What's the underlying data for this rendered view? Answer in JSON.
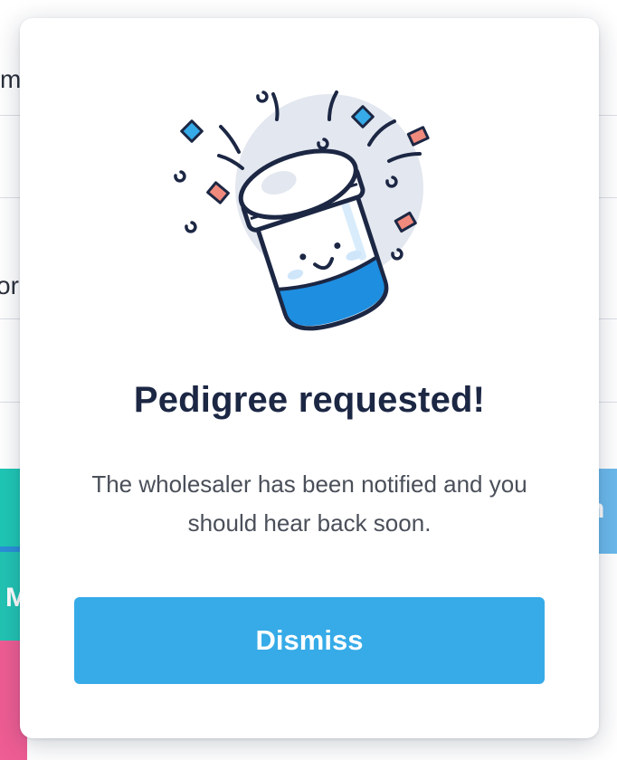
{
  "background": {
    "row_fragments": [
      "m",
      "or"
    ],
    "button_fragments": [
      "M",
      "n"
    ]
  },
  "modal": {
    "illustration_icon": "celebrating-jar-illustration",
    "title": "Pedigree requested!",
    "message": "The wholesaler has been notified and you should hear back soon.",
    "dismiss_label": "Dismiss"
  },
  "colors": {
    "accent": "#36abe8",
    "title": "#1c2744",
    "body_text": "#4a4f59",
    "teal": "#1fc7b5",
    "pink": "#ee5d93"
  }
}
